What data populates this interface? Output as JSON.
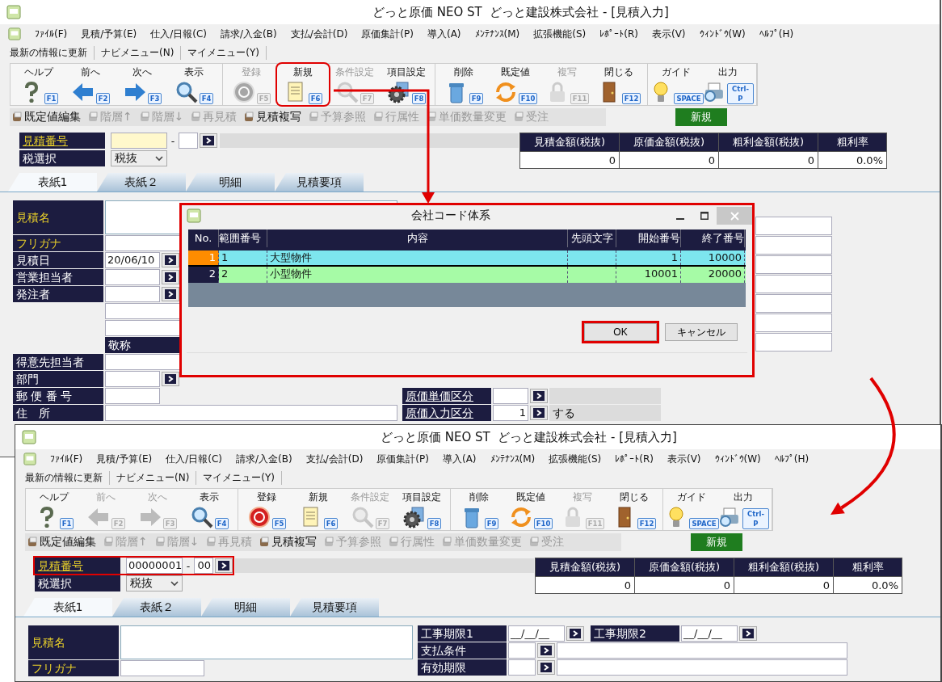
{
  "windows": [
    {
      "title": "どっと原価 NEO ST  どっと建設株式会社 - [見積入力]",
      "menus": [
        "ﾌｧｲﾙ(F)",
        "見積/予算(E)",
        "仕入/日報(C)",
        "請求/入金(B)",
        "支払/会計(D)",
        "原価集計(P)",
        "導入(A)",
        "ﾒﾝﾃﾅﾝｽ(M)",
        "拡張機能(S)",
        "ﾚﾎﾟｰﾄ(R)",
        "表示(V)",
        "ｳｨﾝﾄﾞｳ(W)",
        "ﾍﾙﾌﾟ(H)"
      ],
      "quick_links": [
        "最新の情報に更新",
        "ナビメニュー(N)",
        "マイメニュー(Y)"
      ],
      "toolbar": [
        [
          {
            "label": "ヘルプ",
            "key": "F1",
            "enabled": true,
            "highlighted": false
          },
          {
            "label": "前へ",
            "key": "F2",
            "enabled": true,
            "highlighted": false
          },
          {
            "label": "次へ",
            "key": "F3",
            "enabled": true,
            "highlighted": false
          },
          {
            "label": "表示",
            "key": "F4",
            "enabled": true,
            "highlighted": false
          }
        ],
        [
          {
            "label": "登録",
            "key": "F5",
            "enabled": false,
            "highlighted": false
          },
          {
            "label": "新規",
            "key": "F6",
            "enabled": true,
            "highlighted": true
          },
          {
            "label": "条件設定",
            "key": "F7",
            "enabled": false,
            "highlighted": false
          },
          {
            "label": "項目設定",
            "key": "F8",
            "enabled": true,
            "highlighted": false
          }
        ],
        [
          {
            "label": "削除",
            "key": "F9",
            "enabled": true,
            "highlighted": false
          },
          {
            "label": "既定値",
            "key": "F10",
            "enabled": true,
            "highlighted": false
          },
          {
            "label": "複写",
            "key": "F11",
            "enabled": false,
            "highlighted": false
          },
          {
            "label": "閉じる",
            "key": "F12",
            "enabled": true,
            "highlighted": false
          }
        ],
        [
          {
            "label": "ガイド",
            "key": "SPACE",
            "enabled": true,
            "highlighted": false
          },
          {
            "label": "出力",
            "key": "Ctrl-P",
            "enabled": true,
            "highlighted": false
          }
        ]
      ],
      "subtoolbar": [
        {
          "label": "既定値編集",
          "enabled": true
        },
        {
          "label": "階層↑",
          "enabled": false
        },
        {
          "label": "階層↓",
          "enabled": false
        },
        {
          "label": "再見積",
          "enabled": false
        },
        {
          "label": "見積複写",
          "enabled": true
        },
        {
          "label": "予算参照",
          "enabled": false
        },
        {
          "label": "行属性",
          "enabled": false
        },
        {
          "label": "単価数量変更",
          "enabled": false
        },
        {
          "label": "受注",
          "enabled": false
        }
      ],
      "mode_badge": "新規",
      "estimate_no": {
        "label": "見積番号",
        "separator": "-",
        "focused": true,
        "highlighted": false
      },
      "tax": {
        "label": "税選択",
        "value": "税抜"
      },
      "summary": {
        "columns": [
          "見積金額(税抜)",
          "原価金額(税抜)",
          "粗利金額(税抜)",
          "粗利率"
        ],
        "values": [
          "0",
          "0",
          "0",
          "0.0%"
        ]
      },
      "tabs": [
        {
          "label": "表紙1",
          "selected": true
        },
        {
          "label": "表紙２",
          "selected": false
        },
        {
          "label": "明細",
          "selected": false
        },
        {
          "label": "見積要項",
          "selected": false
        }
      ],
      "form_left": [
        {
          "label": "見積名",
          "kind": "area",
          "required": true
        },
        {
          "label": "フリガナ",
          "kind": "text",
          "required": true
        },
        {
          "label": "見積日",
          "kind": "lookup",
          "value": "20/06/10",
          "required": false
        },
        {
          "label": "営業担当者",
          "kind": "lookup",
          "required": false
        },
        {
          "label": "発注者",
          "kind": "lookup",
          "required": false
        },
        {
          "kind": "blank"
        },
        {
          "kind": "blank"
        },
        {
          "label": "敬称",
          "kind": "caption"
        },
        {
          "label": "得意先担当者",
          "kind": "text",
          "required": false
        },
        {
          "label": "部門",
          "kind": "lookup",
          "required": false
        },
        {
          "label": "郵 便 番 号",
          "kind": "short",
          "required": false
        },
        {
          "label": "住　所",
          "kind": "wide",
          "required": false
        }
      ],
      "form_right": [
        {
          "label": "原価単価区分",
          "kind": "coded",
          "link": true
        },
        {
          "label": "原価入力区分",
          "kind": "coded",
          "link": true,
          "value": "1",
          "note": "する"
        }
      ]
    },
    {
      "title": "どっと原価 NEO ST  どっと建設株式会社 - [見積入力]",
      "menus": [
        "ﾌｧｲﾙ(F)",
        "見積/予算(E)",
        "仕入/日報(C)",
        "請求/入金(B)",
        "支払/会計(D)",
        "原価集計(P)",
        "導入(A)",
        "ﾒﾝﾃﾅﾝｽ(M)",
        "拡張機能(S)",
        "ﾚﾎﾟｰﾄ(R)",
        "表示(V)",
        "ｳｨﾝﾄﾞｳ(W)",
        "ﾍﾙﾌﾟ(H)"
      ],
      "quick_links": [
        "最新の情報に更新",
        "ナビメニュー(N)",
        "マイメニュー(Y)"
      ],
      "toolbar": [
        [
          {
            "label": "ヘルプ",
            "key": "F1",
            "enabled": true,
            "highlighted": false
          },
          {
            "label": "前へ",
            "key": "F2",
            "enabled": false,
            "highlighted": false
          },
          {
            "label": "次へ",
            "key": "F3",
            "enabled": false,
            "highlighted": false
          },
          {
            "label": "表示",
            "key": "F4",
            "enabled": true,
            "highlighted": false
          }
        ],
        [
          {
            "label": "登録",
            "key": "F5",
            "enabled": true,
            "highlighted": false
          },
          {
            "label": "新規",
            "key": "F6",
            "enabled": true,
            "highlighted": false
          },
          {
            "label": "条件設定",
            "key": "F7",
            "enabled": false,
            "highlighted": false
          },
          {
            "label": "項目設定",
            "key": "F8",
            "enabled": true,
            "highlighted": false
          }
        ],
        [
          {
            "label": "削除",
            "key": "F9",
            "enabled": true,
            "highlighted": false
          },
          {
            "label": "既定値",
            "key": "F10",
            "enabled": true,
            "highlighted": false
          },
          {
            "label": "複写",
            "key": "F11",
            "enabled": false,
            "highlighted": false
          },
          {
            "label": "閉じる",
            "key": "F12",
            "enabled": true,
            "highlighted": false
          }
        ],
        [
          {
            "label": "ガイド",
            "key": "SPACE",
            "enabled": true,
            "highlighted": false
          },
          {
            "label": "出力",
            "key": "Ctrl-P",
            "enabled": true,
            "highlighted": false
          }
        ]
      ],
      "subtoolbar": [
        {
          "label": "既定値編集",
          "enabled": true
        },
        {
          "label": "階層↑",
          "enabled": false
        },
        {
          "label": "階層↓",
          "enabled": false
        },
        {
          "label": "再見積",
          "enabled": false
        },
        {
          "label": "見積複写",
          "enabled": true
        },
        {
          "label": "予算参照",
          "enabled": false
        },
        {
          "label": "行属性",
          "enabled": false
        },
        {
          "label": "単価数量変更",
          "enabled": false
        },
        {
          "label": "受注",
          "enabled": false
        }
      ],
      "mode_badge": "新規",
      "estimate_no": {
        "label": "見積番号",
        "number": "00000001",
        "separator": "-",
        "branch": "00",
        "focused": false,
        "highlighted": true
      },
      "tax": {
        "label": "税選択",
        "value": "税抜"
      },
      "summary": {
        "columns": [
          "見積金額(税抜)",
          "原価金額(税抜)",
          "粗利金額(税抜)",
          "粗利率"
        ],
        "values": [
          "0",
          "0",
          "0",
          "0.0%"
        ]
      },
      "tabs": [
        {
          "label": "表紙1",
          "selected": true
        },
        {
          "label": "表紙２",
          "selected": false
        },
        {
          "label": "明細",
          "selected": false
        },
        {
          "label": "見積要項",
          "selected": false
        }
      ],
      "form_left": [
        {
          "label": "見積名",
          "kind": "area",
          "required": true
        },
        {
          "label": "フリガナ",
          "kind": "text",
          "required": true
        }
      ],
      "form_right": [
        {
          "label": "工事期限1",
          "kind": "date",
          "link": false,
          "value": "__/__/__",
          "pair": {
            "label": "工事期限2",
            "value": "__/__/__"
          }
        },
        {
          "label": "支払条件",
          "kind": "memo",
          "link": false
        },
        {
          "label": "有効期限",
          "kind": "memo",
          "link": false
        }
      ]
    }
  ],
  "dialog": {
    "title": "会社コード体系",
    "highlighted": true,
    "columns": [
      "No.",
      "範囲番号",
      "内容",
      "先頭文字",
      "開始番号",
      "終了番号"
    ],
    "rows": [
      {
        "no": "1",
        "range_no": "1",
        "content": "大型物件",
        "start": "1",
        "end": "10000",
        "selected": true,
        "color": "#7de6ee"
      },
      {
        "no": "2",
        "range_no": "2",
        "content": "小型物件",
        "start": "10001",
        "end": "20000",
        "selected": false,
        "color": "#a6fba6"
      }
    ],
    "buttons": [
      {
        "label": "OK",
        "highlighted": true
      },
      {
        "label": "キャンセル",
        "highlighted": false
      }
    ]
  }
}
